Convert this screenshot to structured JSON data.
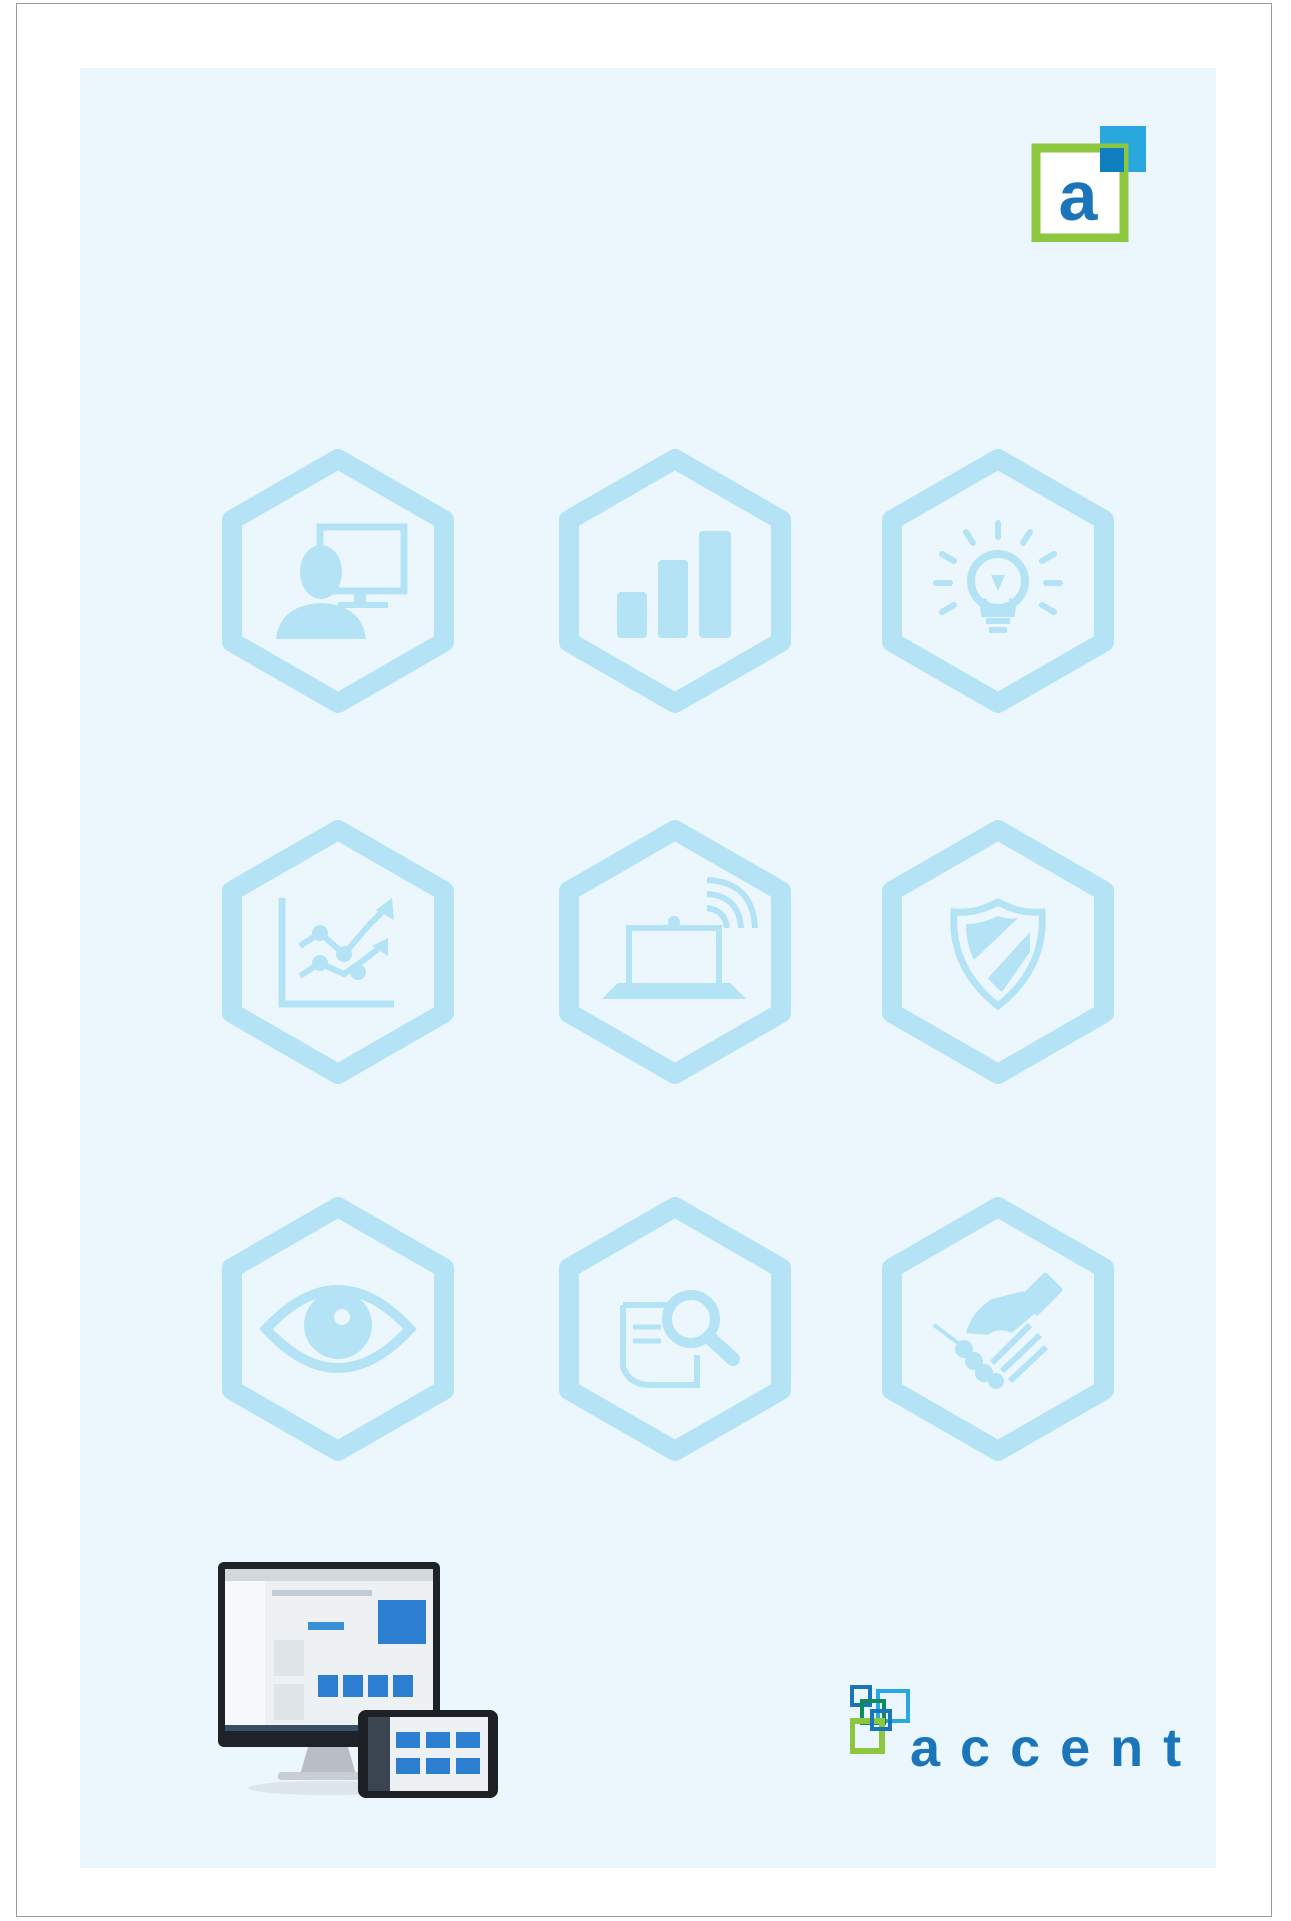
{
  "colors": {
    "panel_background": "#ebf7fd",
    "icon_tint": "#b5e3f6",
    "brand_blue": "#1b75bb",
    "brand_green": "#8dc63f",
    "brand_cyan": "#29a8e0",
    "brand_teal": "#0f8a5f"
  },
  "logo_mark": {
    "letter": "a"
  },
  "icons": [
    {
      "icon": "user-computer-icon"
    },
    {
      "icon": "bar-chart-icon"
    },
    {
      "icon": "lightbulb-icon"
    },
    {
      "icon": "trend-chart-icon"
    },
    {
      "icon": "wireless-laptop-icon"
    },
    {
      "icon": "shield-icon"
    },
    {
      "icon": "eye-icon"
    },
    {
      "icon": "document-search-icon"
    },
    {
      "icon": "handshake-icon"
    }
  ],
  "brand": {
    "wordmark": "accent"
  }
}
